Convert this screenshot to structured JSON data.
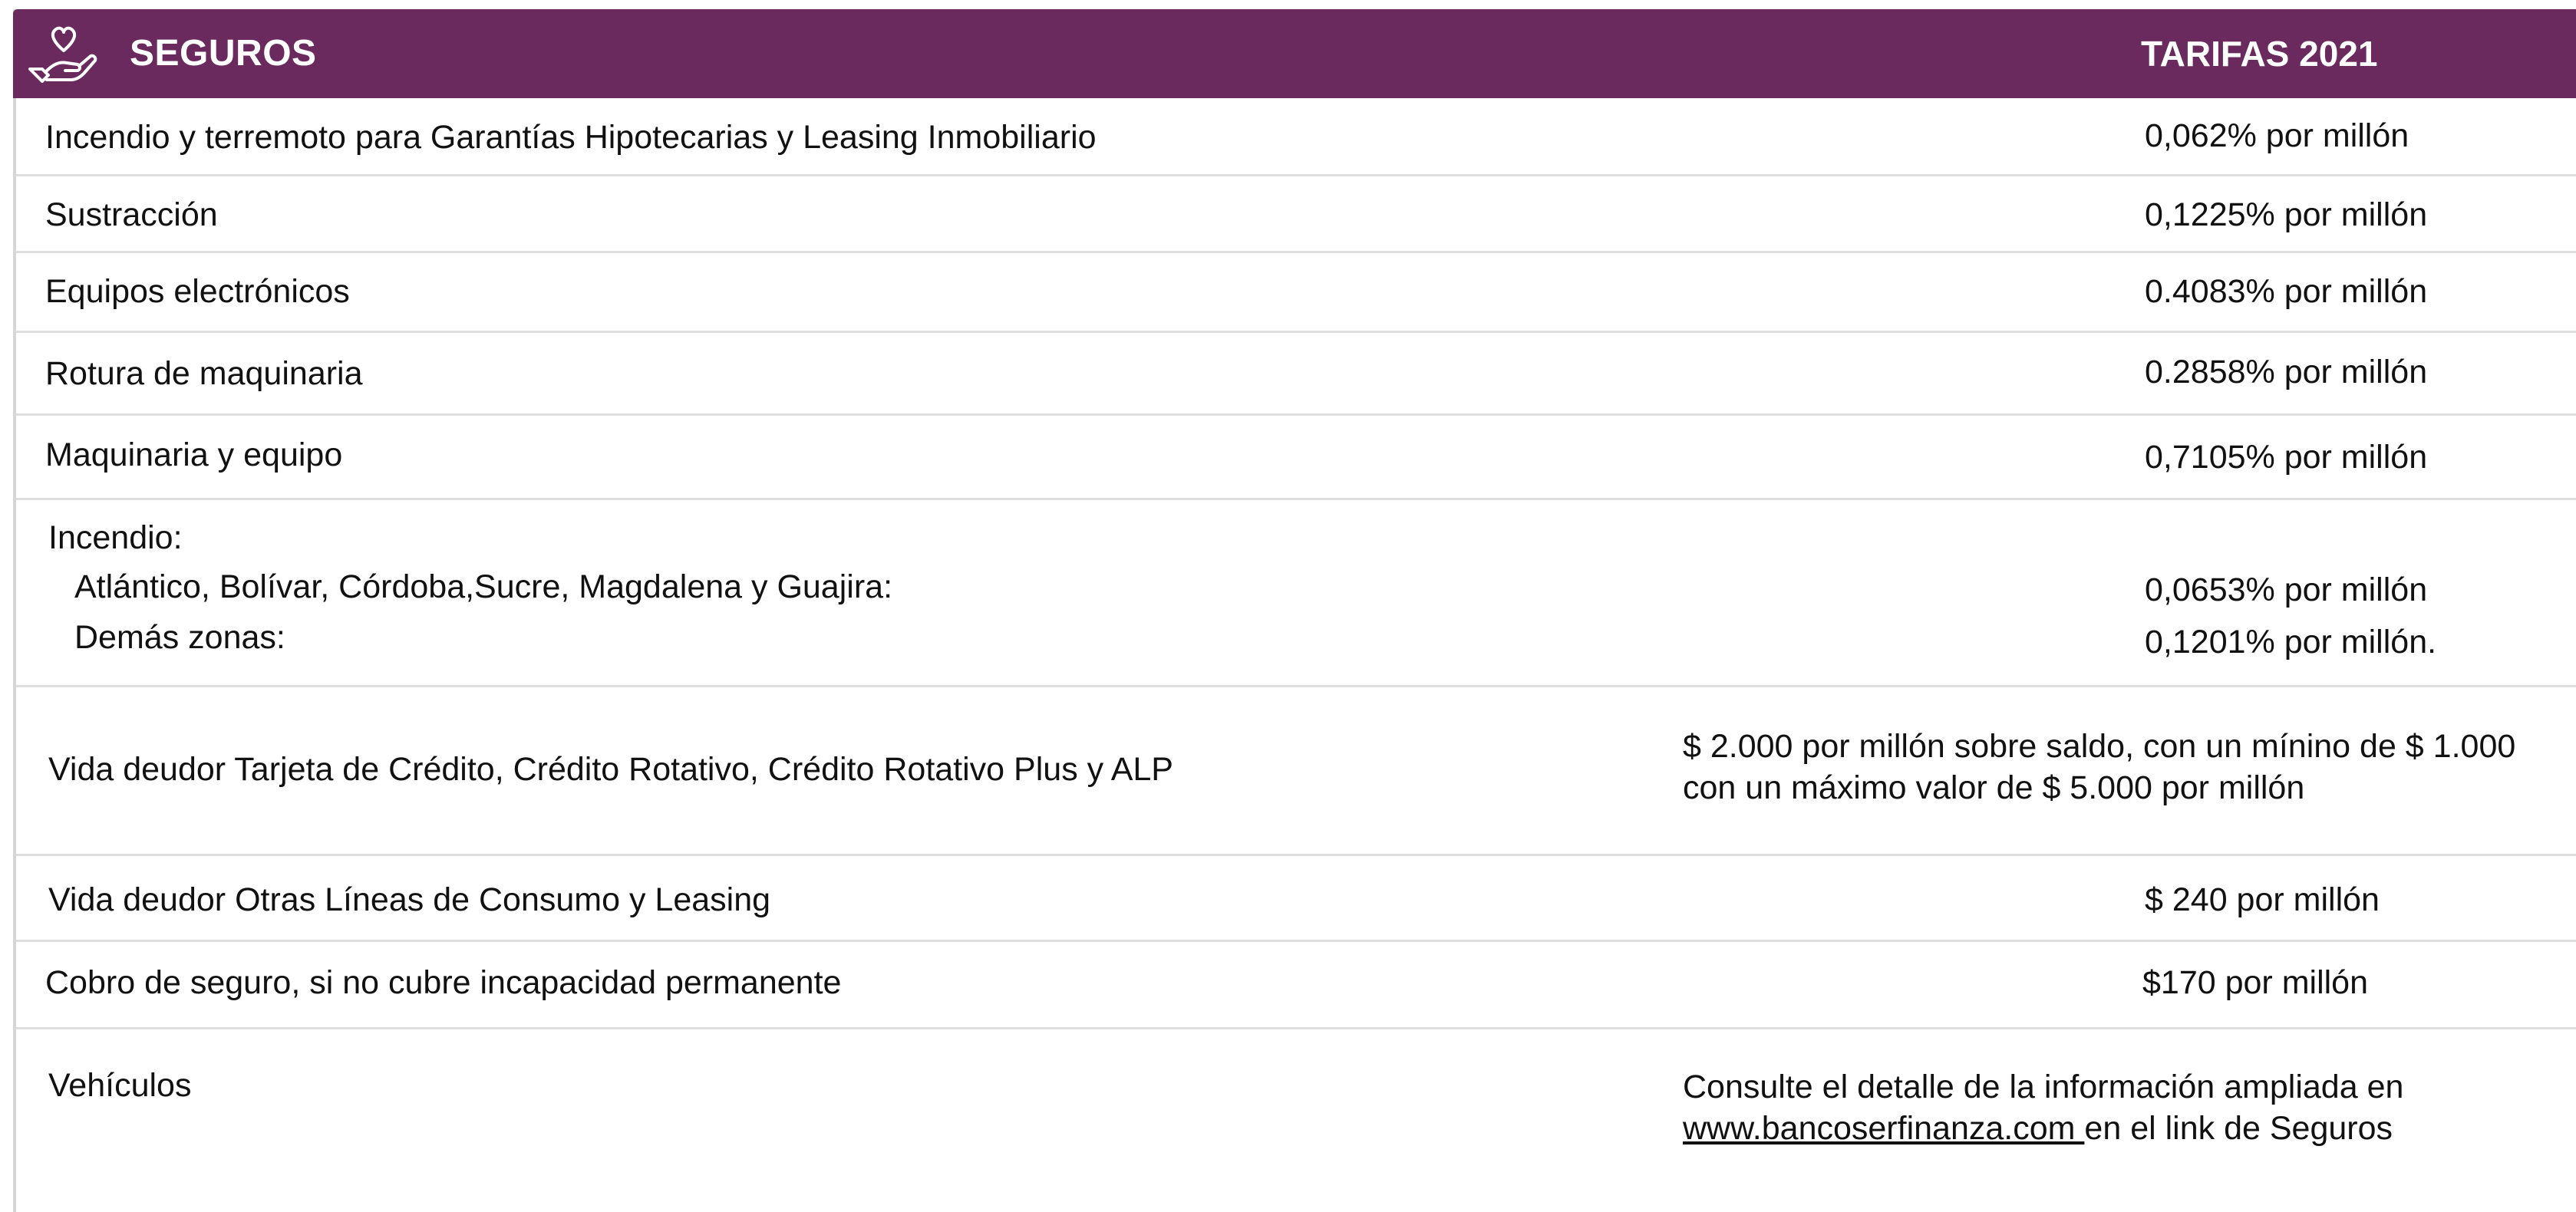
{
  "header": {
    "title": "SEGUROS",
    "tarifas": "TARIFAS 2021",
    "icon": "heart-in-hand-icon"
  },
  "rows": [
    {
      "label": "Incendio y terremoto para Garantías Hipotecarias y Leasing Inmobiliario",
      "value": "0,062% por millón"
    },
    {
      "label": "Sustracción",
      "value": "0,1225% por millón"
    },
    {
      "label": "Equipos electrónicos",
      "value": "0.4083% por millón"
    },
    {
      "label": "Rotura de maquinaria",
      "value": "0.2858% por millón"
    },
    {
      "label": "Maquinaria y equipo",
      "value": "0,7105% por millón"
    }
  ],
  "incendio": {
    "label": "Incendio:",
    "zona1_label": "Atlántico, Bolívar, Córdoba,Sucre, Magdalena y Guajira:",
    "zona1_value": "0,0653% por millón",
    "zona2_label": "Demás zonas:",
    "zona2_value": "0,1201% por millón."
  },
  "vida_tarjeta": {
    "label": "Vida deudor Tarjeta de Crédito, Crédito Rotativo, Crédito Rotativo Plus y ALP",
    "value_line1": "$ 2.000 por millón sobre saldo, con un mínino de $ 1.000",
    "value_line2": "con un máximo valor de $ 5.000 por millón"
  },
  "vida_otras": {
    "label": "Vida deudor Otras Líneas de Consumo y Leasing",
    "value": "$ 240 por millón"
  },
  "cobro": {
    "label": "Cobro de seguro, si no cubre incapacidad permanente",
    "value": "$170 por millón"
  },
  "vehiculos": {
    "label": "Vehículos",
    "value_line1": "Consulte el detalle de la información ampliada en",
    "link": "www.bancoserfinanza.com ",
    "value_line2_rest": "en el link de Seguros"
  },
  "colors": {
    "header_bg": "#6a2a5e",
    "header_text": "#ffffff"
  }
}
